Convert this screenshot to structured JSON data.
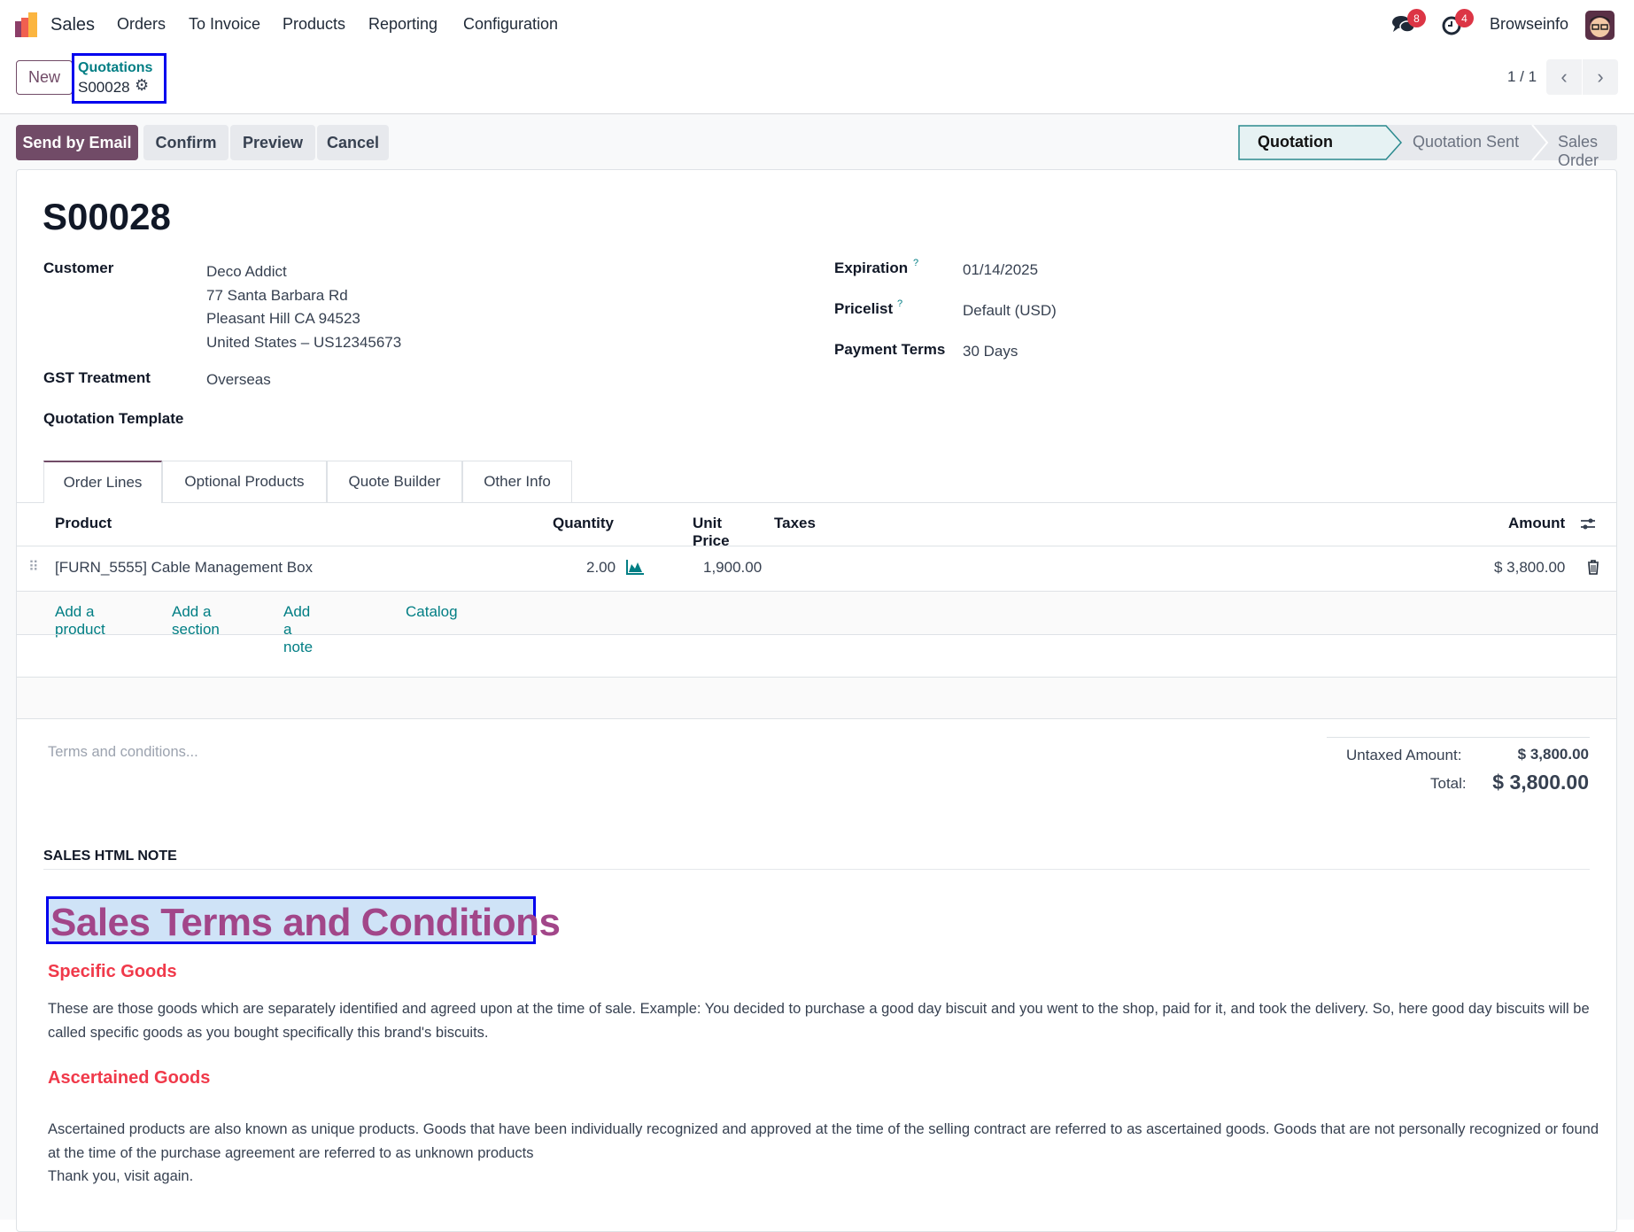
{
  "nav": {
    "app": "Sales",
    "menu": [
      "Orders",
      "To Invoice",
      "Products",
      "Reporting",
      "Configuration"
    ],
    "messages_count": "8",
    "activities_count": "4",
    "user": "Browseinfo"
  },
  "control": {
    "new_label": "New",
    "breadcrumb_parent": "Quotations",
    "breadcrumb_current": "S00028",
    "pager": "1 / 1"
  },
  "actions": {
    "send_email": "Send by Email",
    "confirm": "Confirm",
    "preview": "Preview",
    "cancel": "Cancel"
  },
  "status": {
    "steps": [
      "Quotation",
      "Quotation Sent",
      "Sales Order"
    ],
    "active": "Quotation"
  },
  "form": {
    "title": "S00028",
    "customer_label": "Customer",
    "customer_lines": [
      "Deco Addict",
      "77 Santa Barbara Rd",
      "Pleasant Hill CA 94523",
      "United States – US12345673"
    ],
    "gst_label": "GST Treatment",
    "gst_value": "Overseas",
    "template_label": "Quotation Template",
    "expiration_label": "Expiration",
    "expiration_value": "01/14/2025",
    "pricelist_label": "Pricelist",
    "pricelist_value": "Default (USD)",
    "terms_label": "Payment Terms",
    "terms_value": "30 Days",
    "help": "?"
  },
  "tabs": [
    "Order Lines",
    "Optional Products",
    "Quote Builder",
    "Other Info"
  ],
  "table": {
    "headers": {
      "product": "Product",
      "quantity": "Quantity",
      "unit_price": "Unit Price",
      "taxes": "Taxes",
      "amount": "Amount"
    },
    "rows": [
      {
        "product": "[FURN_5555] Cable Management Box",
        "quantity": "2.00",
        "unit_price": "1,900.00",
        "taxes": "",
        "amount": "$ 3,800.00"
      }
    ],
    "add_product": "Add a product",
    "add_section": "Add a section",
    "add_note": "Add a note",
    "catalog": "Catalog"
  },
  "terms_placeholder": "Terms and conditions...",
  "totals": {
    "untaxed_label": "Untaxed Amount:",
    "untaxed_value": "$ 3,800.00",
    "total_label": "Total:",
    "total_value": "$ 3,800.00"
  },
  "note": {
    "section_title": "SALES HTML NOTE",
    "heading": "Sales Terms and Conditions",
    "sub1": "Specific Goods",
    "para1": "These are those goods which are separately identified and agreed upon at the time of sale. Example: You decided to purchase a good day biscuit and you went to the shop, paid for it, and took the delivery. So, here good day biscuits will be called specific goods as you bought specifically this brand's biscuits.",
    "sub2": "Ascertained Goods",
    "para2": "Ascertained products are also known as unique products. Goods that have been individually recognized and approved at the time of the selling contract are referred to as ascertained goods. Goods that are not personally recognized or found at the time of the purchase agreement are referred to as unknown products",
    "para3": "Thank you, visit again."
  },
  "colors": {
    "primary": "#714b67",
    "link": "#017e84",
    "heading": "#a24689",
    "subheading": "#f0394a"
  }
}
